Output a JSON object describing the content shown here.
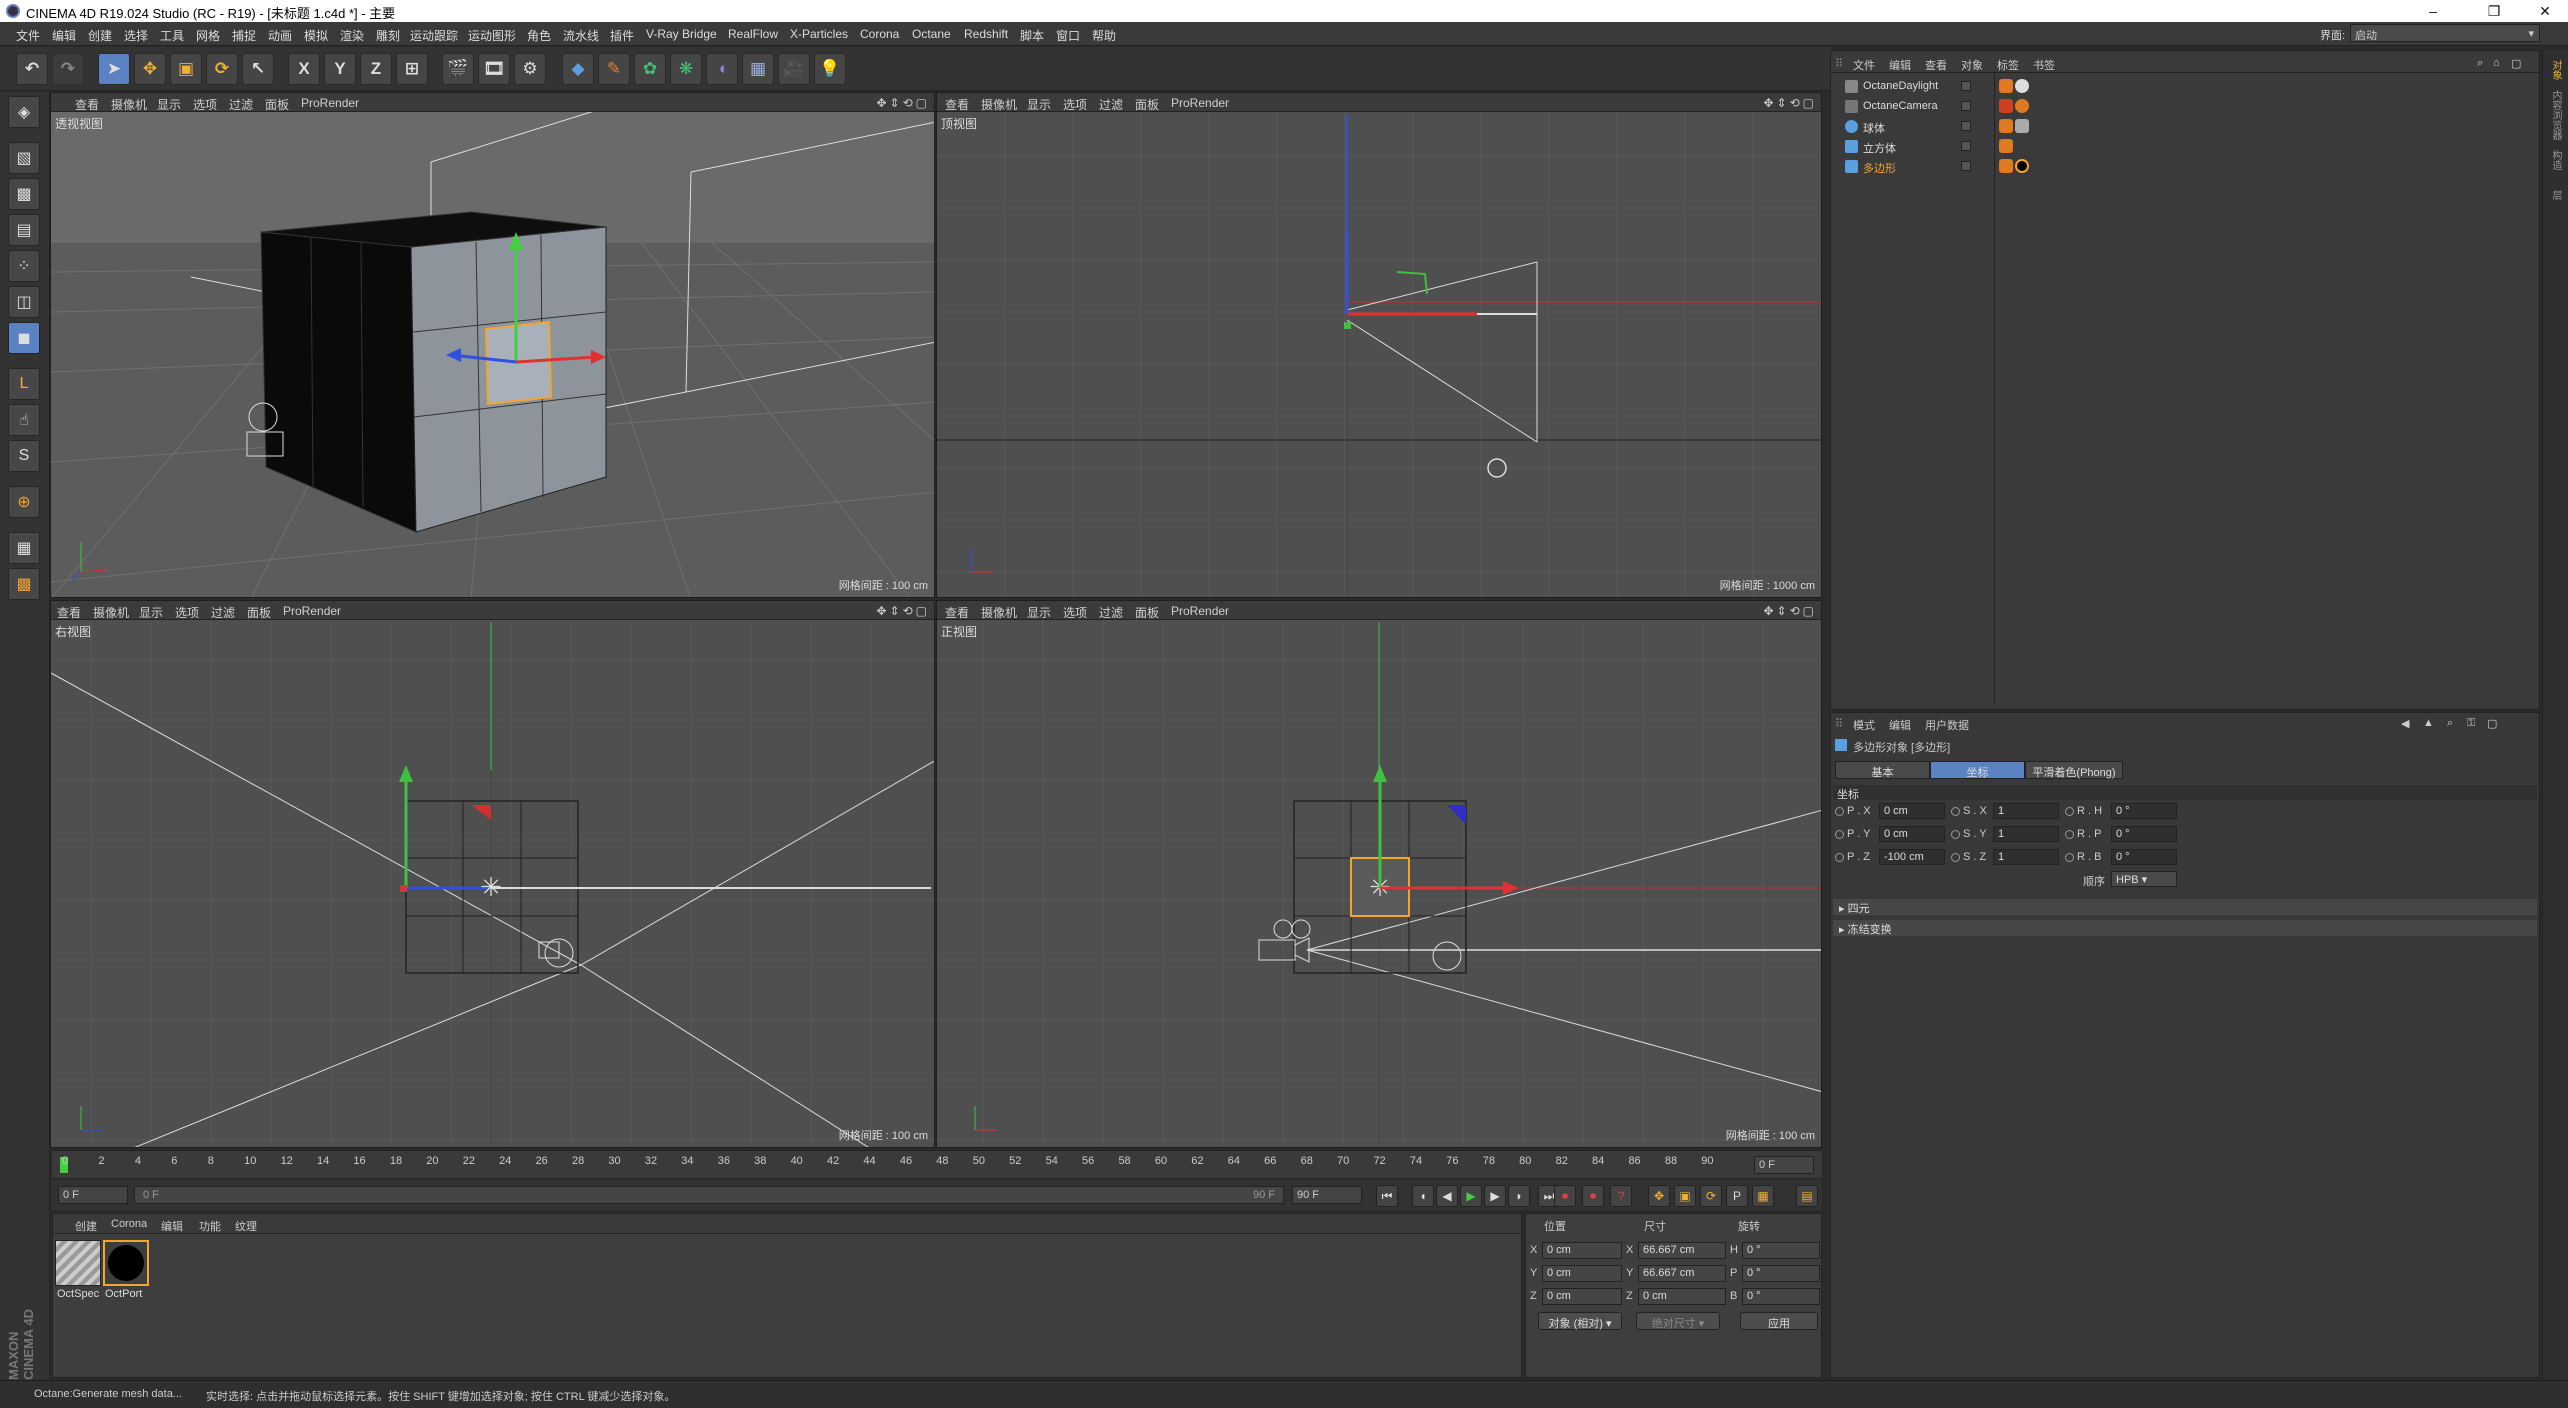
{
  "title": "CINEMA 4D R19.024 Studio (RC - R19) - [未标题 1.c4d *] - 主要",
  "menus": [
    "文件",
    "编辑",
    "创建",
    "选择",
    "工具",
    "网格",
    "捕捉",
    "动画",
    "模拟",
    "渲染",
    "雕刻",
    "运动跟踪",
    "运动图形",
    "角色",
    "流水线",
    "插件",
    "V-Ray Bridge",
    "RealFlow",
    "X-Particles",
    "Corona",
    "Octane",
    "Redshift",
    "脚本",
    "窗口",
    "帮助"
  ],
  "layout": {
    "label": "界面:",
    "value": "启动"
  },
  "toolbar": {
    "x": "X",
    "y": "Y",
    "z": "Z"
  },
  "viewport_menu_a": [
    "查看",
    "摄像机",
    "显示",
    "选项",
    "过滤",
    "面板",
    "ProRender"
  ],
  "viewport_menu_b": [
    "查看",
    "摄像机",
    "显示",
    "选项",
    "过滤",
    "面板",
    "ProRender"
  ],
  "viewports": {
    "persp": {
      "name": "透视视图",
      "grid": "网格间距 : 100 cm"
    },
    "top": {
      "name": "顶视图",
      "grid": "网格间距 : 1000 cm"
    },
    "right": {
      "name": "右视图",
      "grid": "网格间距 : 100 cm"
    },
    "front": {
      "name": "正视图",
      "grid": "网格间距 : 100 cm"
    }
  },
  "timeline": {
    "ticks": [
      "0",
      "2",
      "4",
      "6",
      "8",
      "10",
      "12",
      "14",
      "16",
      "18",
      "20",
      "22",
      "24",
      "26",
      "28",
      "30",
      "32",
      "34",
      "36",
      "38",
      "40",
      "42",
      "44",
      "46",
      "48",
      "50",
      "52",
      "54",
      "56",
      "58",
      "60",
      "62",
      "64",
      "66",
      "68",
      "70",
      "72",
      "74",
      "76",
      "78",
      "80",
      "82",
      "84",
      "86",
      "88",
      "90"
    ],
    "frame": "0 F"
  },
  "playback": {
    "start": "0 F",
    "cur": "0 F",
    "end": "90 F",
    "end2": "90 F"
  },
  "materials": {
    "menu": [
      "创建",
      "Corona",
      "编辑",
      "功能",
      "纹理"
    ],
    "items": [
      {
        "name": "OctSpec"
      },
      {
        "name": "OctPort"
      }
    ]
  },
  "coords": {
    "headers": [
      "位置",
      "尺寸",
      "旋转"
    ],
    "rows": [
      {
        "pl": "X",
        "p": "0 cm",
        "sl": "X",
        "s": "66.667 cm",
        "rl": "H",
        "r": "0 °"
      },
      {
        "pl": "Y",
        "p": "0 cm",
        "sl": "Y",
        "s": "66.667 cm",
        "rl": "P",
        "r": "0 °"
      },
      {
        "pl": "Z",
        "p": "0 cm",
        "sl": "Z",
        "s": "0 cm",
        "rl": "B",
        "r": "0 °"
      }
    ],
    "mode": "对象 (相对)",
    "size_mode": "绝对尺寸",
    "apply": "应用"
  },
  "status": {
    "left": "Octane:Generate mesh data...",
    "hint": "实时选择: 点击并拖动鼠标选择元素。按住 SHIFT 键增加选择对象; 按住 CTRL 键减少选择对象。"
  },
  "objmgr": {
    "menu": [
      "文件",
      "编辑",
      "查看",
      "对象",
      "标签",
      "书签"
    ],
    "objects": [
      {
        "name": "OctaneDaylight",
        "color": "#cccccc"
      },
      {
        "name": "OctaneCamera",
        "color": "#cccccc"
      },
      {
        "name": "球体",
        "color": "#5aa0e0"
      },
      {
        "name": "立方体",
        "color": "#5aa0e0"
      },
      {
        "name": "多边形",
        "color": "#5aa0e0",
        "selected": true
      }
    ]
  },
  "attr": {
    "menu": [
      "模式",
      "编辑",
      "用户数据"
    ],
    "object": "多边形对象 [多边形]",
    "tabs": [
      "基本",
      "坐标",
      "平滑着色(Phong)"
    ],
    "active_tab": 1,
    "section": "坐标",
    "rows": [
      {
        "pl": "P . X",
        "p": "0 cm",
        "sl": "S . X",
        "s": "1",
        "rl": "R . H",
        "r": "0 °"
      },
      {
        "pl": "P . Y",
        "p": "0 cm",
        "sl": "S . Y",
        "s": "1",
        "rl": "R . P",
        "r": "0 °"
      },
      {
        "pl": "P . Z",
        "p": "-100 cm",
        "sl": "S . Z",
        "s": "1",
        "rl": "R . B",
        "r": "0 °"
      }
    ],
    "order_label": "顺序",
    "order": "HPB",
    "collapsed": [
      "四元",
      "冻结变换"
    ]
  },
  "sidetabs": [
    "对象",
    "内容浏览器",
    "构造",
    "层"
  ],
  "colors": {
    "accent": "#5b82c2",
    "selected": "#f3a52e"
  }
}
